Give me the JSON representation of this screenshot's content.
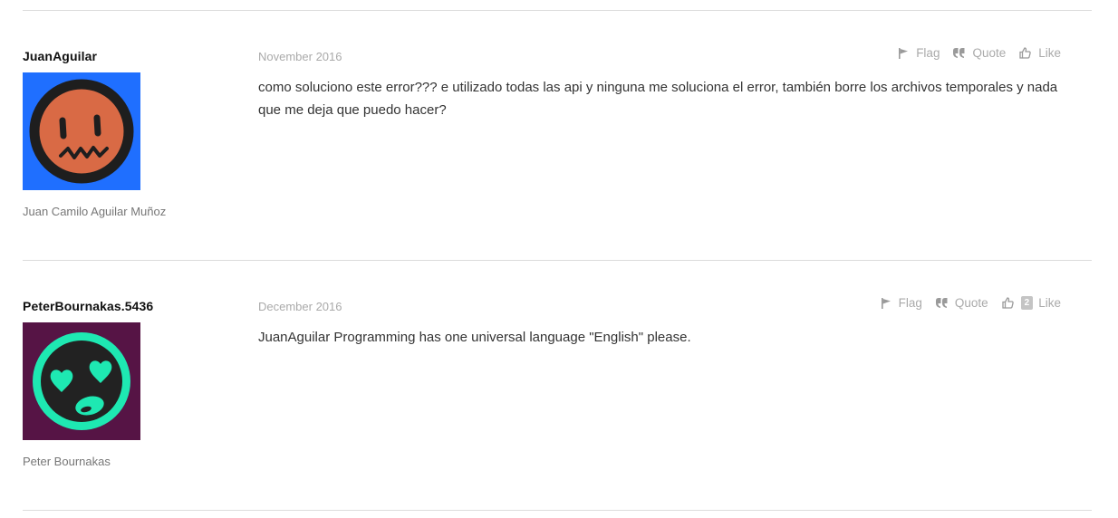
{
  "posts": [
    {
      "username": "JuanAguilar",
      "realname": "Juan Camilo Aguilar Muñoz",
      "date": "November 2016",
      "message": "como soluciono este error??? e utilizado todas las api y ninguna me soluciona el error, también borre los archivos temporales y nada que me deja que puedo hacer?",
      "avatar": {
        "icon": "worried-face-avatar",
        "bg": "#1f6fff",
        "face": "#d96a45",
        "stroke": "#1e1e1e"
      },
      "actions": {
        "flag": "Flag",
        "quote": "Quote",
        "like": "Like",
        "like_count": ""
      }
    },
    {
      "username": "PeterBournakas.5436",
      "realname": "Peter Bournakas",
      "date": "December 2016",
      "message": "JuanAguilar Programming has one universal language \"English\" please.",
      "avatar": {
        "icon": "heart-eyes-face-avatar",
        "bg": "#561445",
        "face": "#1ee8b2",
        "stroke": "#222222"
      },
      "actions": {
        "flag": "Flag",
        "quote": "Quote",
        "like": "Like",
        "like_count": "2"
      }
    }
  ]
}
